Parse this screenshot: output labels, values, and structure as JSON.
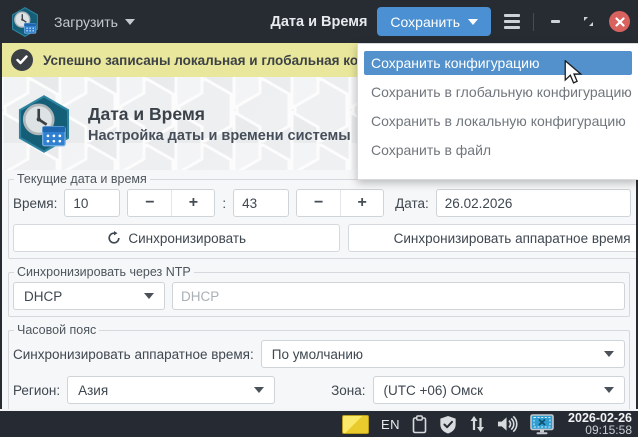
{
  "window": {
    "title": "Дата и Время",
    "load_label": "Загрузить",
    "save_label": "Сохранить"
  },
  "notification": {
    "text": "Успешно записаны локальная и глобальная конф"
  },
  "save_menu": {
    "items": [
      {
        "label": "Сохранить конфигурацию",
        "selected": true
      },
      {
        "label": "Сохранить в глобальную конфигурацию",
        "selected": false
      },
      {
        "label": "Сохранить в локальную конфигурацию",
        "selected": false
      },
      {
        "label": "Сохранить в файл",
        "selected": false
      }
    ]
  },
  "header": {
    "title": "Дата и Время",
    "subtitle": "Настройка даты и времени системы"
  },
  "current_section": {
    "legend": "Текущие дата и время",
    "time_label": "Время:",
    "hours_value": "10",
    "minutes_value": "43",
    "minus_label": "−",
    "plus_label": "+",
    "colon": ":",
    "date_label": "Дата:",
    "date_value": "26.02.2026",
    "sync_button": "Синхронизировать",
    "sync_hw_button": "Синхронизировать аппаратное время"
  },
  "ntp_section": {
    "legend": "Синхронизировать через NTP",
    "mode_value": "DHCP",
    "server_placeholder": "DHCP"
  },
  "timezone_section": {
    "legend": "Часовой пояс",
    "hw_sync_label": "Синхронизировать аппаратное время:",
    "hw_sync_value": "По умолчанию",
    "region_label": "Регион:",
    "region_value": "Азия",
    "zone_label": "Зона:",
    "zone_value": "(UTC +06) Омск"
  },
  "taskbar": {
    "lang": "EN",
    "date": "2026-02-26",
    "time": "09:15:58",
    "icons": [
      "keyboard-layout-icon",
      "clipboard-icon",
      "shield-icon",
      "network-arrows-icon",
      "volume-icon",
      "screenshot-monitor-icon"
    ]
  },
  "colors": {
    "accent_blue": "#4a90d2",
    "menu_highlight_blue": "#5291cc",
    "notification_yellow": "#e9e79b",
    "titlebar_dark": "#272c33",
    "taskbar_dark": "#262b33",
    "close_red": "#d9625f",
    "content_bg": "#f6f7f8",
    "screen_blue": "#2e9ed2"
  }
}
